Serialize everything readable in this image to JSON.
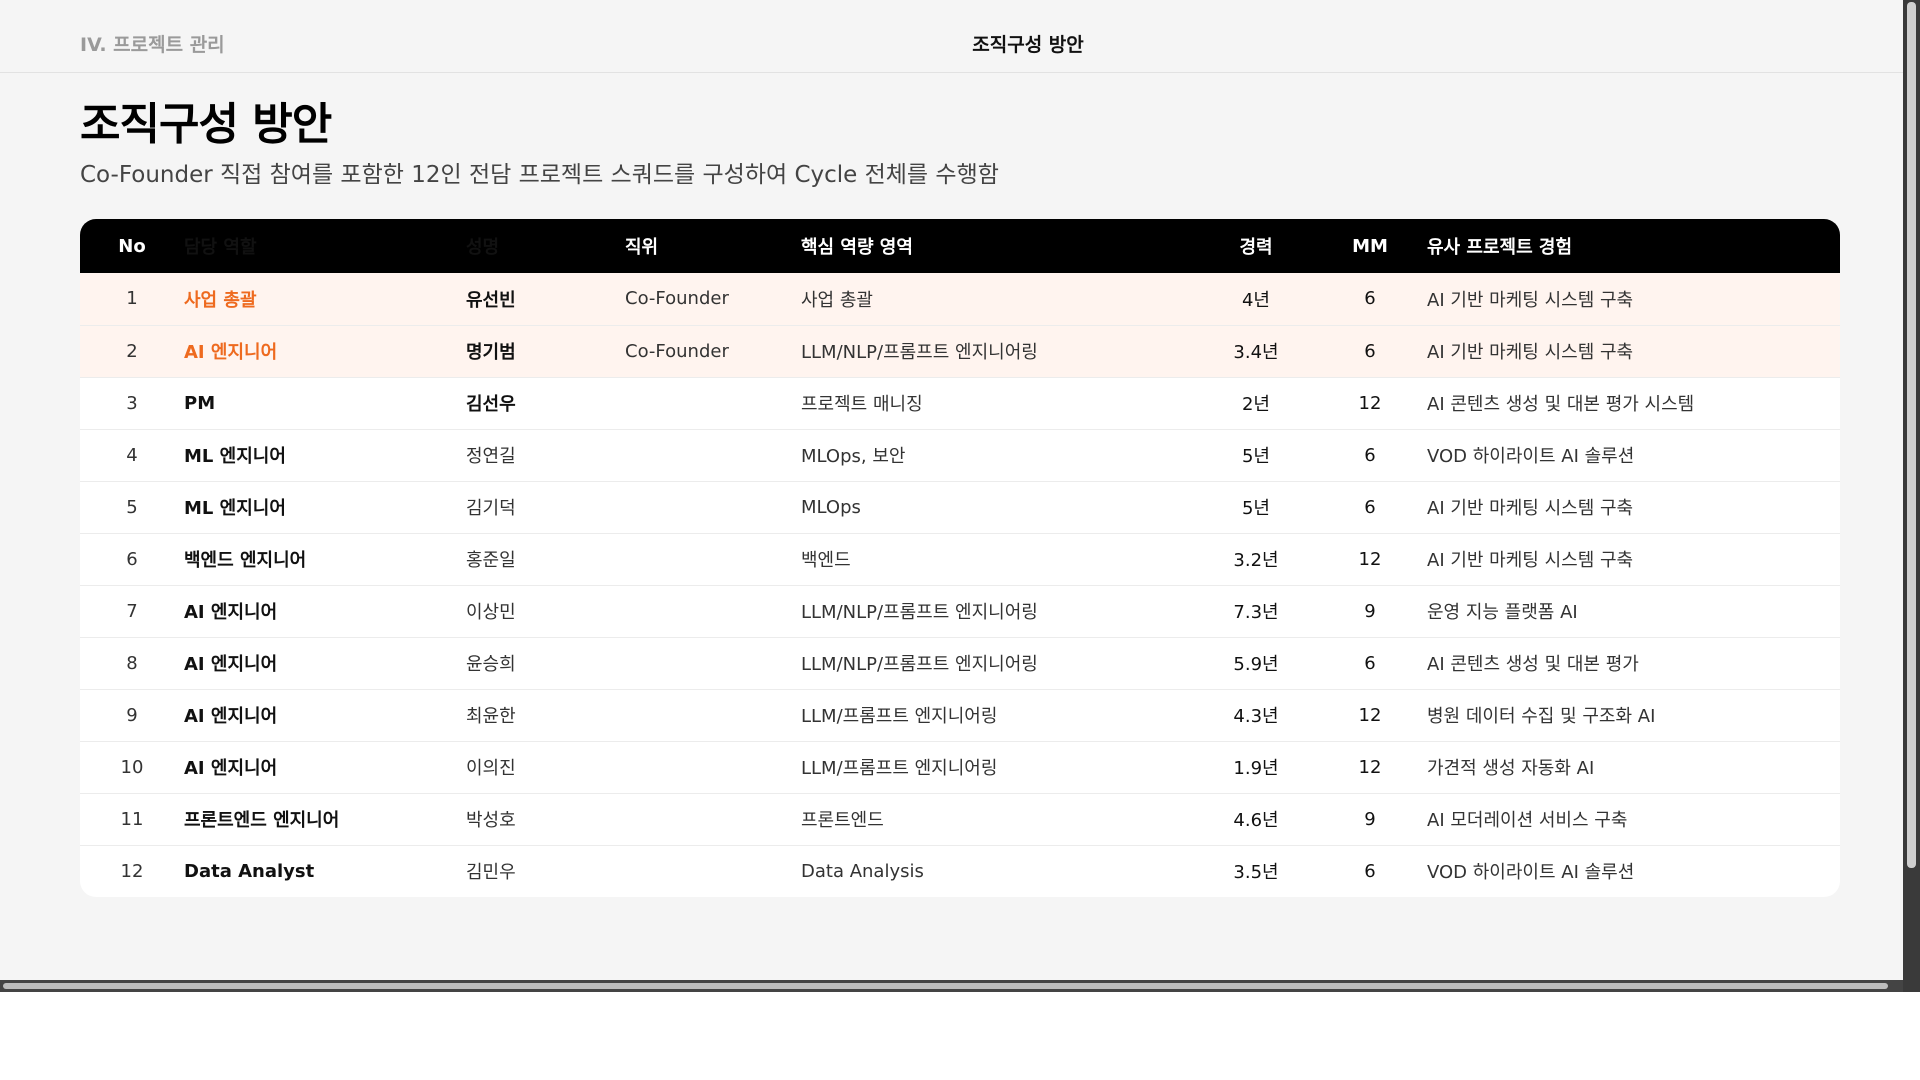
{
  "header": {
    "section": "IV. 프로젝트 관리",
    "center_title": "조직구성 방안"
  },
  "page": {
    "title": "조직구성 방안",
    "subtitle": "Co-Founder 직접 참여를 포함한 12인 전담 프로젝트 스쿼드를 구성하여 Cycle 전체를 수행함"
  },
  "table": {
    "columns": [
      "No",
      "담당 역할",
      "성명",
      "직위",
      "핵심 역량 영역",
      "경력",
      "MM",
      "유사 프로젝트 경험"
    ],
    "rows": [
      {
        "no": "1",
        "role": "사업 총괄",
        "name": "유선빈",
        "position": "Co-Founder",
        "area": "사업 총괄",
        "career": "4년",
        "mm": "6",
        "project": "AI 기반 마케팅 시스템 구축"
      },
      {
        "no": "2",
        "role": "AI 엔지니어",
        "name": "명기범",
        "position": "Co-Founder",
        "area": "LLM/NLP/프롬프트 엔지니어링",
        "career": "3.4년",
        "mm": "6",
        "project": "AI 기반 마케팅 시스템 구축"
      },
      {
        "no": "3",
        "role": "PM",
        "name": "김선우",
        "position": "",
        "area": "프로젝트 매니징",
        "career": "2년",
        "mm": "12",
        "project": "AI 콘텐츠 생성 및 대본 평가 시스템"
      },
      {
        "no": "4",
        "role": "ML 엔지니어",
        "name": "정연길",
        "position": "",
        "area": "MLOps, 보안",
        "career": "5년",
        "mm": "6",
        "project": "VOD 하이라이트 AI 솔루션"
      },
      {
        "no": "5",
        "role": "ML 엔지니어",
        "name": "김기덕",
        "position": "",
        "area": "MLOps",
        "career": "5년",
        "mm": "6",
        "project": "AI 기반 마케팅 시스템 구축"
      },
      {
        "no": "6",
        "role": "백엔드 엔지니어",
        "name": "홍준일",
        "position": "",
        "area": "백엔드",
        "career": "3.2년",
        "mm": "12",
        "project": "AI 기반 마케팅 시스템 구축"
      },
      {
        "no": "7",
        "role": "AI 엔지니어",
        "name": "이상민",
        "position": "",
        "area": "LLM/NLP/프롬프트 엔지니어링",
        "career": "7.3년",
        "mm": "9",
        "project": "운영 지능 플랫폼 AI"
      },
      {
        "no": "8",
        "role": "AI 엔지니어",
        "name": "윤승희",
        "position": "",
        "area": "LLM/NLP/프롬프트 엔지니어링",
        "career": "5.9년",
        "mm": "6",
        "project": "AI 콘텐츠 생성 및 대본 평가"
      },
      {
        "no": "9",
        "role": "AI 엔지니어",
        "name": "최윤한",
        "position": "",
        "area": "LLM/프롬프트 엔지니어링",
        "career": "4.3년",
        "mm": "12",
        "project": "병원 데이터 수집 및 구조화 AI"
      },
      {
        "no": "10",
        "role": "AI 엔지니어",
        "name": "이의진",
        "position": "",
        "area": "LLM/프롬프트 엔지니어링",
        "career": "1.9년",
        "mm": "12",
        "project": "가견적 생성 자동화 AI"
      },
      {
        "no": "11",
        "role": "프론트엔드 엔지니어",
        "name": "박성호",
        "position": "",
        "area": "프론트엔드",
        "career": "4.6년",
        "mm": "9",
        "project": "AI 모더레이션 서비스 구축"
      },
      {
        "no": "12",
        "role": "Data Analyst",
        "name": "김민우",
        "position": "",
        "area": "Data Analysis",
        "career": "3.5년",
        "mm": "6",
        "project": "VOD 하이라이트 AI 솔루션"
      }
    ]
  },
  "colors": {
    "highlight_row": "#fff4ef",
    "highlight_text": "#ee6a1f",
    "header_bg": "#000000"
  }
}
